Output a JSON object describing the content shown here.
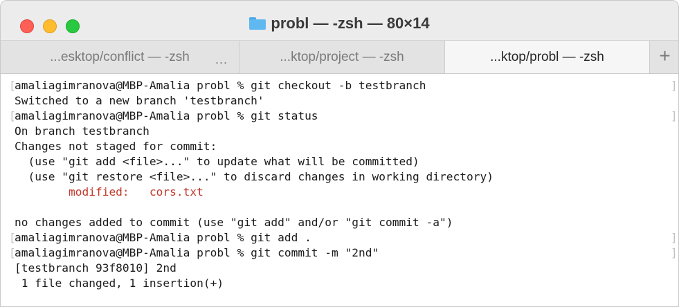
{
  "window": {
    "title": "probl — -zsh — 80×14"
  },
  "tabs": [
    {
      "label": "...esktop/conflict — -zsh",
      "active": false,
      "ellipsis": "..."
    },
    {
      "label": "...ktop/project — -zsh",
      "active": false
    },
    {
      "label": "...ktop/probl — -zsh",
      "active": true
    }
  ],
  "new_tab_label": "+",
  "terminal": {
    "lines": [
      "amaliagimranova@MBP-Amalia probl % git checkout -b testbranch",
      "Switched to a new branch 'testbranch'",
      "amaliagimranova@MBP-Amalia probl % git status",
      "On branch testbranch",
      "Changes not staged for commit:",
      "  (use \"git add <file>...\" to update what will be committed)",
      "  (use \"git restore <file>...\" to discard changes in working directory)",
      "        modified:   cors.txt",
      "",
      "no changes added to commit (use \"git add\" and/or \"git commit -a\")",
      "amaliagimranova@MBP-Amalia probl % git add .",
      "amaliagimranova@MBP-Amalia probl % git commit -m \"2nd\"",
      "[testbranch 93f8010] 2nd",
      " 1 file changed, 1 insertion(+)"
    ],
    "modified_color": "#c0392b"
  },
  "colors": {
    "close": "#fe5f57",
    "minimize": "#febc2e",
    "zoom": "#28c840",
    "folder": "#5fb9f0"
  }
}
